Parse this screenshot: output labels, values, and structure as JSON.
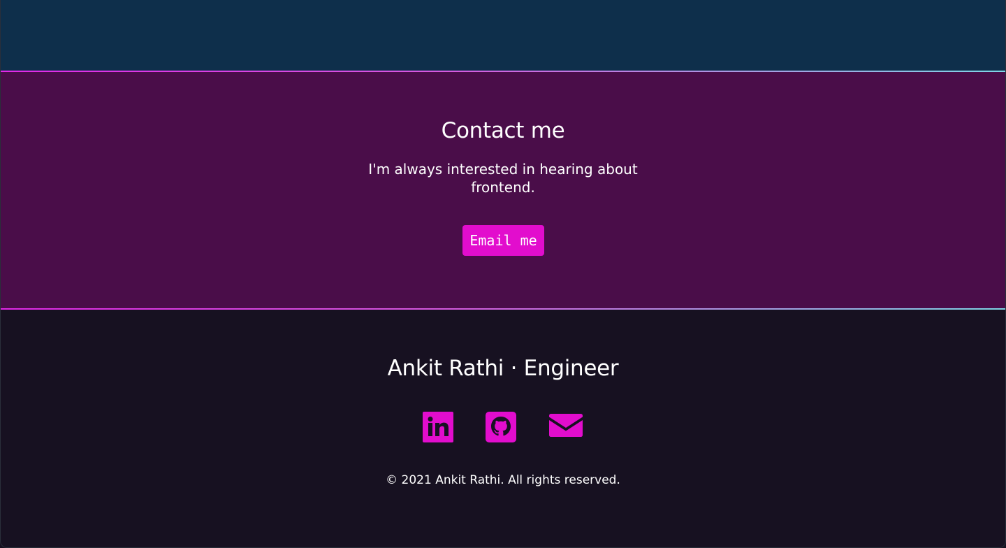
{
  "contact": {
    "title": "Contact me",
    "text": "I'm always interested in hearing about frontend.",
    "button_label": "Email me"
  },
  "footer": {
    "name": "Ankit Rathi · Engineer",
    "copyright": "© 2021 Ankit Rathi. All rights reserved.",
    "social_links": [
      {
        "icon": "linkedin-icon"
      },
      {
        "icon": "github-icon"
      },
      {
        "icon": "mail-icon"
      }
    ]
  },
  "colors": {
    "top_band": "#0e2f4b",
    "contact_background": "#4a0d49",
    "footer_background": "#171121",
    "accent": "#e20dcd",
    "divider_start": "#e228e8",
    "divider_end": "#7fd5e6",
    "text": "#ffffff"
  }
}
